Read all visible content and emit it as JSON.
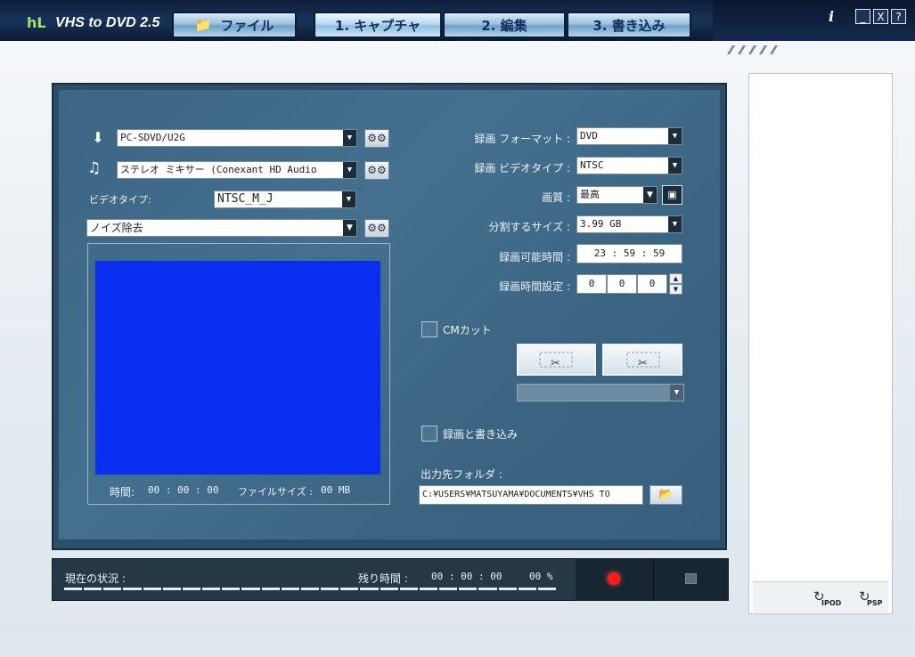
{
  "app": {
    "title": "VHS to DVD 2.5",
    "logo": "hL"
  },
  "tabs": {
    "file": "ファイル",
    "capture": "1. キャプチャ",
    "edit": "2. 編集",
    "write": "3. 書き込み"
  },
  "window_controls": {
    "info": "i",
    "minimize": "_",
    "close": "X",
    "help": "?"
  },
  "left": {
    "device": "PC-SDVD/U2G",
    "audio": "ステレオ ミキサー (Conexant HD Audio",
    "video_type_label": "ビデオタイプ:",
    "video_type": "NTSC_M_J",
    "filter": "ノイズ除去",
    "preview_color": "#0a2ef0",
    "time_label": "時間:",
    "time_value": "00 : 00 : 00",
    "filesize_label": "ファイルサイズ :",
    "filesize_value": "00 MB"
  },
  "right": {
    "format_label": "録画 フォーマット :",
    "format_value": "DVD",
    "videotype_label": "録画 ビデオタイプ :",
    "videotype_value": "NTSC",
    "quality_label": "画質 :",
    "quality_value": "最高",
    "split_label": "分割するサイズ :",
    "split_value": "3.99 GB",
    "available_label": "録画可能時間 :",
    "available_value": "23 : 59 : 59",
    "setting_label": "録画時間設定 :",
    "setting_h": "0",
    "setting_m": "0",
    "setting_s": "0",
    "cm_cut": "CMカット",
    "record_write": "録画と書き込み",
    "output_label": "出力先フォルダ :",
    "output_path": "C:¥USERS¥MATSUYAMA¥DOCUMENTS¥VHS TO"
  },
  "status": {
    "current_label": "現在の状況 :",
    "remaining_label": "残り時間 :",
    "remaining_value": "00 : 00 : 00",
    "percent": "00 %",
    "record_color": "#ff1a1a"
  },
  "side": {
    "ipod": "IPOD",
    "psp": "PSP"
  }
}
